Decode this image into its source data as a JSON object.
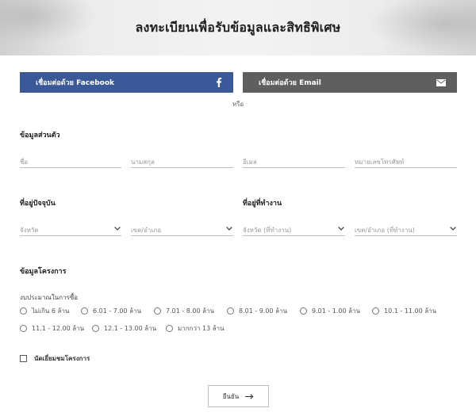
{
  "header": {
    "title": "ลงทะเบียนเพื่อรับข้อมูลและสิทธิพิเศษ"
  },
  "social": {
    "facebook_label": "เชื่อมต่อด้วย Facebook",
    "email_label": "เชื่อมต่อด้วย Email",
    "facebook_color": "#3b5998",
    "email_color": "#5f5f5f",
    "or_text": "หรือ"
  },
  "personal": {
    "title": "ข้อมูลส่วนตัว",
    "fields": [
      {
        "placeholder": "ชื่อ"
      },
      {
        "placeholder": "นามสกุล"
      },
      {
        "placeholder": "อีเมล"
      },
      {
        "placeholder": "หมายเลขโทรศัพท์"
      }
    ]
  },
  "current_address": {
    "title": "ที่อยู่ปัจจุบัน",
    "province": "จังหวัด",
    "district": "เขต/อำเภอ"
  },
  "work_address": {
    "title": "ที่อยู่ที่ทำงาน",
    "province": "จังหวัด (ที่ทำงาน)",
    "district": "เขต/อำเภอ (ที่ทำงาน)"
  },
  "project": {
    "title": "ข้อมูลโครงการ",
    "budget_label": "งบประมาณในการซื้อ",
    "budget_options": [
      "ไม่เกิน 6 ล้าน",
      "6.01 - 7.00 ล้าน",
      "7.01 - 8.00 ล้าน",
      "8.01 - 9.00 ล้าน",
      "9.01 - 1.00 ล้าน",
      "10.1 - 11.00 ล้าน",
      "11.1 - 12.00 ล้าน",
      "12.1 - 13.00 ล้าน",
      "มากกว่า 13 ล้าน"
    ],
    "visit_label": "นัดเยี่ยมชมโครงการ"
  },
  "submit": {
    "label": "ยืนยัน"
  }
}
